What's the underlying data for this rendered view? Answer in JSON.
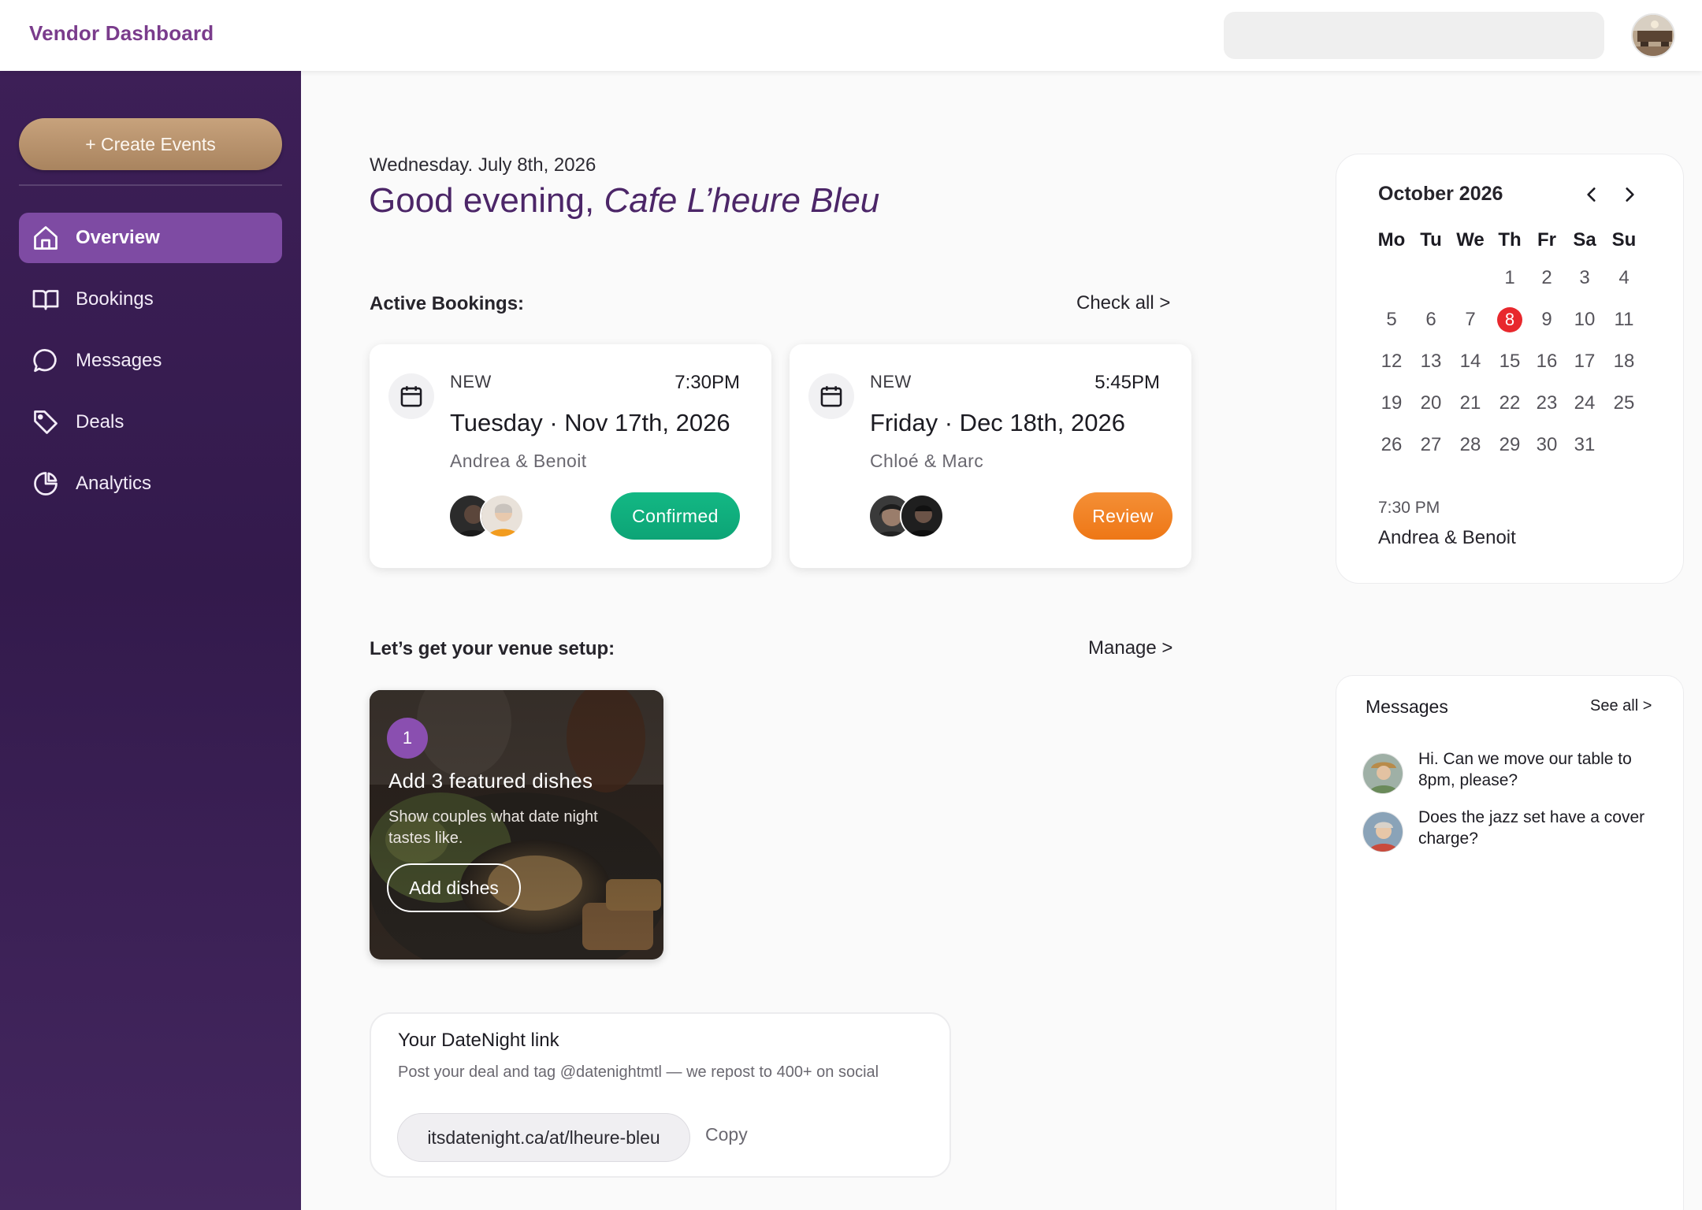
{
  "header": {
    "brand": "Vendor Dashboard",
    "search_placeholder": "",
    "avatar_icon": "venue-photo-avatar"
  },
  "sidebar": {
    "create_label": "+ Create Events",
    "items": [
      {
        "label": "Overview",
        "icon": "home-icon",
        "active": true
      },
      {
        "label": "Bookings",
        "icon": "book-icon",
        "active": false
      },
      {
        "label": "Messages",
        "icon": "chat-bubble-icon",
        "active": false
      },
      {
        "label": "Deals",
        "icon": "tag-icon",
        "active": false
      },
      {
        "label": "Analytics",
        "icon": "pie-chart-icon",
        "active": false
      }
    ]
  },
  "main": {
    "date": "Wednesday. July 8th, 2026",
    "greeting_prefix": "Good evening, ",
    "venue_name": "Cafe L’heure Bleu",
    "active_bookings": {
      "title": "Active Bookings:",
      "link": "Check all >",
      "cards": [
        {
          "status": "NEW",
          "time": "7:30PM",
          "date": "Tuesday · Nov 17th, 2026",
          "names": "Andrea & Benoit",
          "action": "Confirmed"
        },
        {
          "status": "NEW",
          "time": "5:45PM",
          "date": "Friday · Dec 18th, 2026",
          "names": "Chloé & Marc",
          "action": "Review"
        }
      ]
    },
    "venue_setup": {
      "title": "Let’s get your venue setup:",
      "link": "Manage >",
      "card": {
        "step": "1",
        "title": "Add 3 featured dishes",
        "description": "Show couples what date night tastes like.",
        "button": "Add dishes"
      }
    },
    "datenight_link": {
      "title": "Your DateNight link",
      "description": "Post your deal and tag @datenightmtl — we repost to 400+ on social",
      "url": "itsdatenight.ca/at/lheure-bleu",
      "copy_label": "Copy"
    }
  },
  "calendar": {
    "month": "October 2026",
    "weekdays": [
      "Mo",
      "Tu",
      "We",
      "Th",
      "Fr",
      "Sa",
      "Su"
    ],
    "weeks": [
      [
        "",
        "",
        "",
        "1",
        "2",
        "3",
        "4"
      ],
      [
        "5",
        "6",
        "7",
        "8",
        "9",
        "10",
        "11"
      ],
      [
        "12",
        "13",
        "14",
        "15",
        "16",
        "17",
        "18"
      ],
      [
        "19",
        "20",
        "21",
        "22",
        "23",
        "24",
        "25"
      ],
      [
        "26",
        "27",
        "28",
        "29",
        "30",
        "31",
        ""
      ]
    ],
    "highlighted_day": "8",
    "highlight_color": "#e8282d",
    "event": {
      "time": "7:30 PM",
      "names": "Andrea & Benoit"
    }
  },
  "messages": {
    "title": "Messages",
    "see_all": "See all >",
    "items": [
      {
        "text": "Hi. Can we move our table to 8pm, please?"
      },
      {
        "text": "Does the jazz set have a cover charge?"
      }
    ]
  },
  "colors": {
    "brand_purple": "#7a3c8c",
    "sidebar_active": "#7e4ba3",
    "confirmed_green": "#13b884",
    "review_orange": "#f48f36",
    "create_gold": "#c7a27c"
  }
}
